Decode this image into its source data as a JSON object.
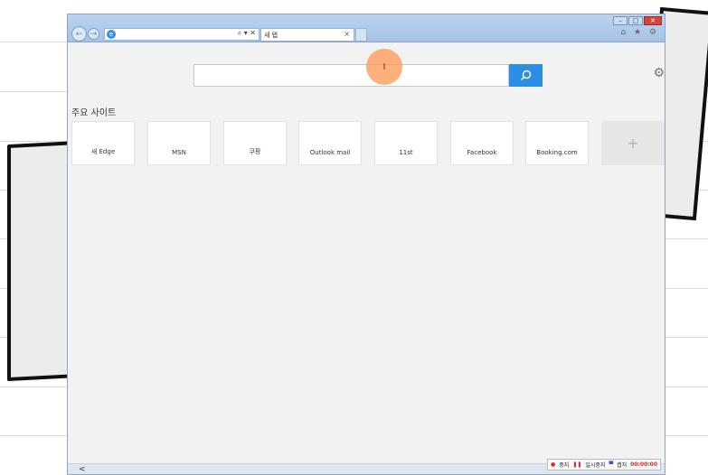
{
  "browser": {
    "address_text": "",
    "tab_label": "새 탭",
    "tab_close": "×",
    "addr_tools": "⌕ ▾ ✕",
    "toolbar_icons": "⌂ ★ ⚙",
    "back_glyph": "←",
    "forward_glyph": "→",
    "win_min": "–",
    "win_max": "□",
    "win_close": "✕"
  },
  "start_page": {
    "search_placeholder": "",
    "search_icon": "search-icon",
    "cursor_text": "I",
    "section_title": "주요 사이트",
    "tiles": [
      {
        "label": "새 Edge"
      },
      {
        "label": "MSN"
      },
      {
        "label": "쿠팡"
      },
      {
        "label": "Outlook mail"
      },
      {
        "label": "11st"
      },
      {
        "label": "Facebook"
      },
      {
        "label": "Booking.com"
      }
    ],
    "add_tile": "+"
  },
  "status": {
    "scroll_left": "<",
    "recorder": {
      "stop": "중지",
      "pause": "일시중지",
      "capture": "캡처",
      "time": "00:00:00"
    }
  },
  "colors": {
    "accent": "#2d8ee8",
    "cursor_highlight": "#ff9650"
  }
}
